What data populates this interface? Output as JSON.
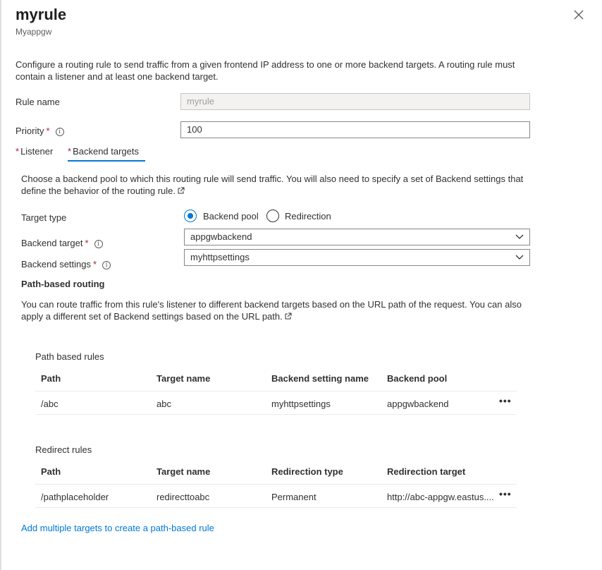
{
  "header": {
    "title": "myrule",
    "subtitle": "Myappgw"
  },
  "description": "Configure a routing rule to send traffic from a given frontend IP address to one or more backend targets. A routing rule must contain a listener and at least one backend target.",
  "form": {
    "rule_name_label": "Rule name",
    "rule_name_value": "myrule",
    "priority_label": "Priority",
    "priority_value": "100"
  },
  "tabs": [
    {
      "label": "Listener",
      "required": "*",
      "active": false
    },
    {
      "label": "Backend targets",
      "required": "*",
      "active": true
    }
  ],
  "backend": {
    "description": "Choose a backend pool to which this routing rule will send traffic. You will also need to specify a set of Backend settings that define the behavior of the routing rule.",
    "target_type_label": "Target type",
    "target_type_options": [
      "Backend pool",
      "Redirection"
    ],
    "target_type_selected": "Backend pool",
    "backend_target_label": "Backend target",
    "backend_target_value": "appgwbackend",
    "backend_settings_label": "Backend settings",
    "backend_settings_value": "myhttpsettings"
  },
  "path_routing": {
    "heading": "Path-based routing",
    "description": "You can route traffic from this rule's listener to different backend targets based on the URL path of the request. You can also apply a different set of Backend settings based on the URL path."
  },
  "path_rules": {
    "caption": "Path based rules",
    "columns": [
      "Path",
      "Target name",
      "Backend setting name",
      "Backend pool"
    ],
    "rows": [
      {
        "path": "/abc",
        "target_name": "abc",
        "backend_setting": "myhttpsettings",
        "backend_pool": "appgwbackend",
        "more": "•••"
      }
    ]
  },
  "redirect_rules": {
    "caption": "Redirect rules",
    "columns": [
      "Path",
      "Target name",
      "Redirection type",
      "Redirection target"
    ],
    "rows": [
      {
        "path": "/pathplaceholder",
        "target_name": "redirecttoabc",
        "redirection_type": "Permanent",
        "redirection_target": "http://abc-appgw.eastus....",
        "more": "•••"
      }
    ]
  },
  "footer_link": "Add multiple targets to create a path-based rule",
  "colors": {
    "accent": "#0078d4",
    "required": "#a4262c"
  }
}
